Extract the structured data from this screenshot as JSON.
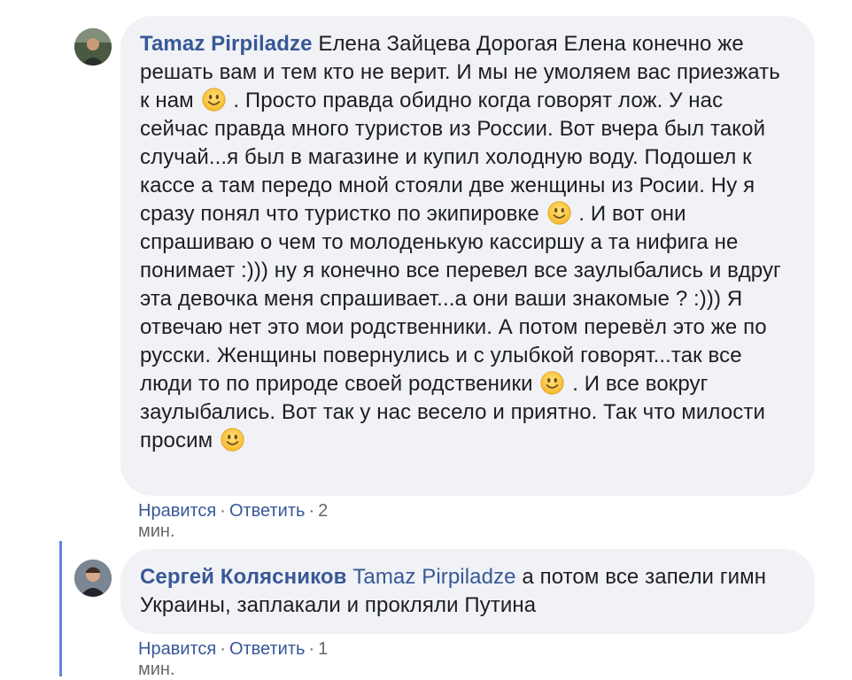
{
  "comments": [
    {
      "author": "Tamaz Pirpiladze",
      "text_segments": [
        " Елена Зайцева Дорогая Елена конечно же решать вам и тем кто не верит. И мы не умоляем вас приезжать к нам ",
        " . Просто правда обидно когда говорят лож. У нас сейчас правда много туристов из России. Вот вчера был такой случай...я был в магазине и купил холодную воду. Подошел к кассе а там передо мной стояли две женщины из Росии. Ну я сразу понял что туристко по экипировке ",
        " . И вот они спрашиваю о чем то молоденькую кассиршу а та нифига не понимает :))) ну я конечно все перевел все заулыбались и вдруг эта девочка меня спрашивает...а они ваши знакомые ? :))) Я отвечаю нет это мои родственники. А потом перевёл это же по русски. Женщины повернулись и с улыбкой говорят...так все люди то по природе своей родственики ",
        " . И все вокруг заулыбались. Вот так у нас весело и приятно. Так что милости просим "
      ],
      "emoji": "slightly-smiling-face",
      "like_label": "Нравится",
      "reply_label": "Ответить",
      "time": "2 мин."
    },
    {
      "author": "Сергей Колясников",
      "mention": "Tamaz Pirpiladze",
      "text": " а потом все запели гимн Украины, заплакали и прокляли Путина",
      "like_label": "Нравится",
      "reply_label": "Ответить",
      "time": "1 мин."
    }
  ],
  "colors": {
    "name_blue": "#385898",
    "bubble_bg": "#f0f2f5",
    "meta_gray": "#65676b",
    "thread_line": "#5b86e5"
  }
}
